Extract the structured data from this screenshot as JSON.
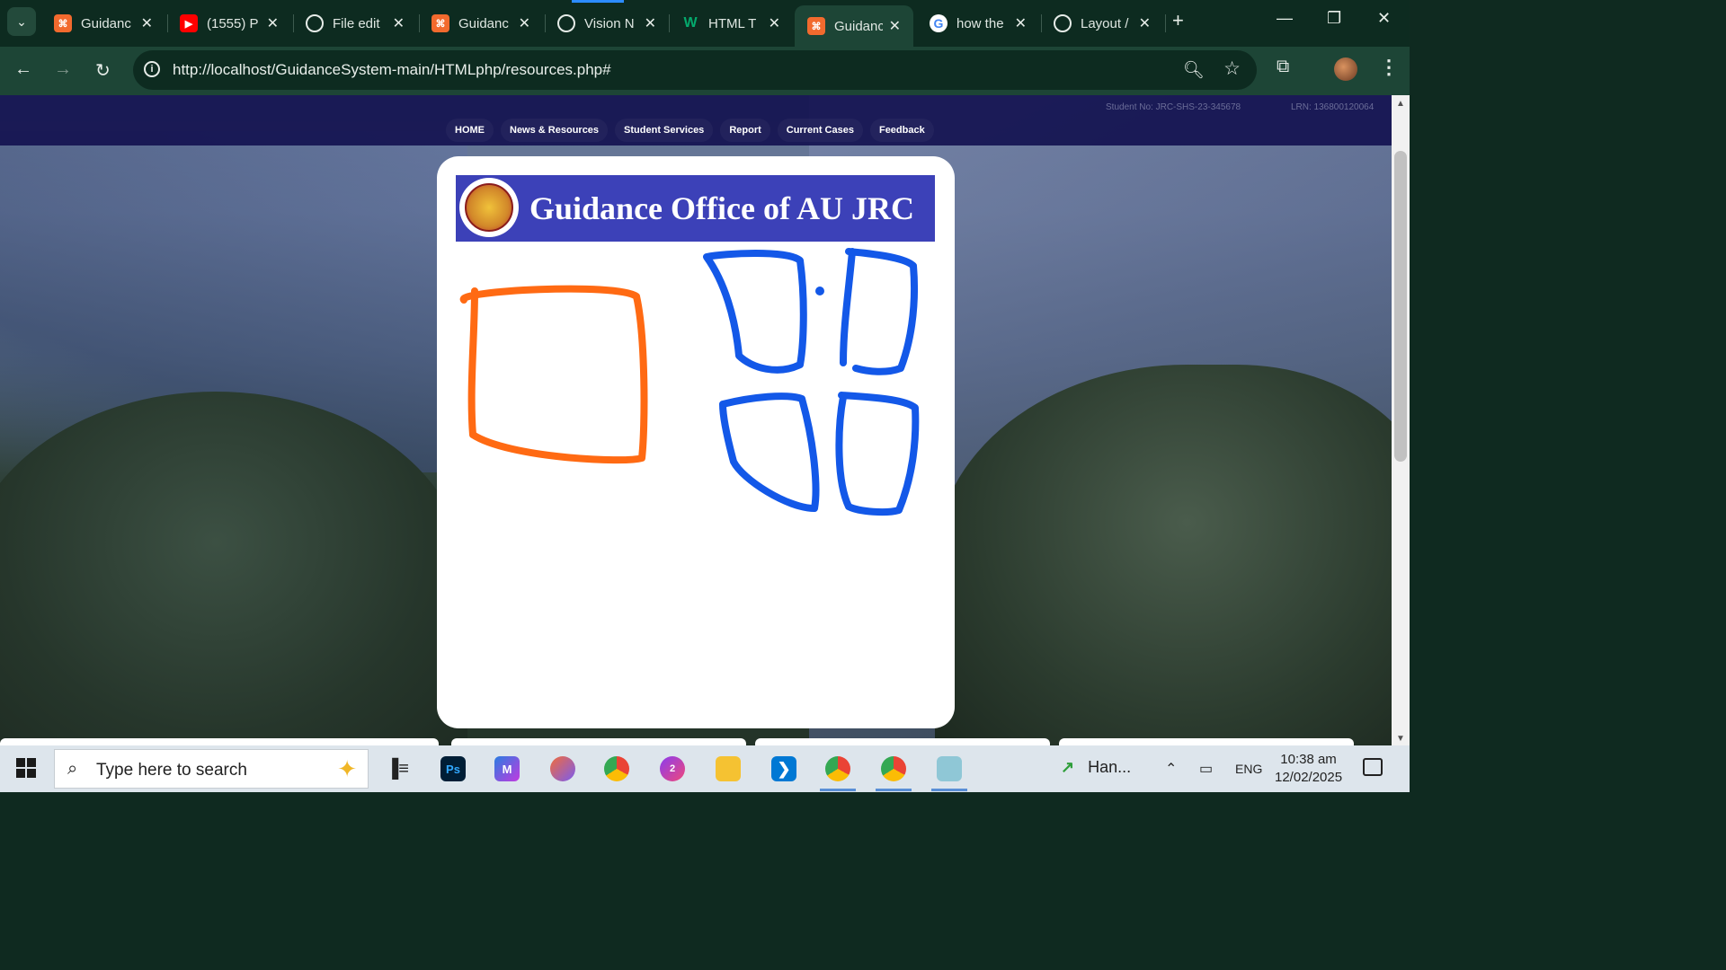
{
  "browser": {
    "tabs": [
      {
        "title": "Guidanc",
        "favicon": "xampp-icon",
        "color": "#f26a2e"
      },
      {
        "title": "(1555) P",
        "favicon": "youtube-icon",
        "color": "#ff0000"
      },
      {
        "title": "File edit",
        "favicon": "openai-icon",
        "color": "#0d2b20"
      },
      {
        "title": "Guidanc",
        "favicon": "xampp-icon",
        "color": "#f26a2e"
      },
      {
        "title": "Vision N",
        "favicon": "openai-icon",
        "color": "#0d2b20"
      },
      {
        "title": "HTML T",
        "favicon": "w3schools-icon",
        "color": "#04aa6d"
      },
      {
        "title": "Guidanc",
        "favicon": "xampp-icon",
        "color": "#f26a2e",
        "active": true
      },
      {
        "title": "how the",
        "favicon": "google-icon",
        "color": "#ffffff"
      },
      {
        "title": "Layout /",
        "favicon": "openai-icon",
        "color": "#0d2b20"
      }
    ],
    "url": "http://localhost/GuidanceSystem-main/HTMLphp/resources.php#"
  },
  "site": {
    "student_no": "Student No: JRC-SHS-23-345678",
    "lrn": "LRN: 136800120064",
    "nav": [
      "HOME",
      "News & Resources",
      "Student Services",
      "Report",
      "Current Cases",
      "Feedback"
    ],
    "banner_title": "Guidance Office of AU JRC",
    "seal_text": "ARELLANO UNIVERSITY MANILA 1938"
  },
  "sketch": {
    "orange_color": "#ff6a13",
    "blue_color": "#1358e8"
  },
  "taskbar": {
    "search_placeholder": "Type here to search",
    "tray_app": "Han...",
    "language": "ENG",
    "time": "10:38 am",
    "date": "12/02/2025",
    "messenger_badge": "2"
  }
}
